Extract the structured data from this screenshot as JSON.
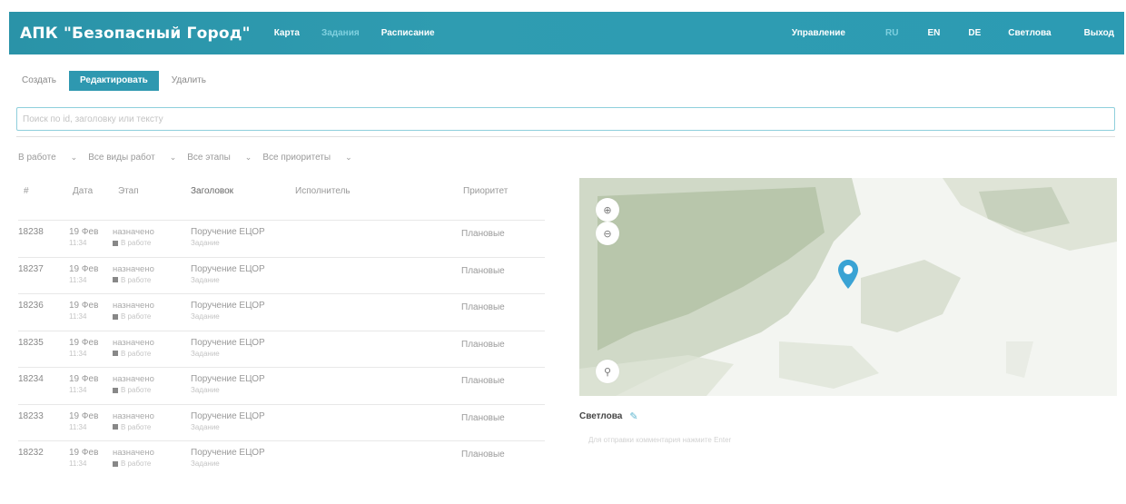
{
  "header": {
    "brand": "АПК \"Безопасный Город\"",
    "nav": [
      "Карта",
      "Задания",
      "Расписание"
    ],
    "right": {
      "manage": "Управление",
      "langs": [
        "RU",
        "EN",
        "DE"
      ],
      "user": "Светлова",
      "logout": "Выход"
    }
  },
  "toolbar": {
    "create": "Создать",
    "edit": "Редактировать",
    "delete": "Удалить"
  },
  "search": {
    "placeholder": "Поиск по id, заголовку или тексту"
  },
  "filters": [
    "В работе",
    "Все виды работ",
    "Все этапы",
    "Все приоритеты"
  ],
  "table": {
    "headers": {
      "id": "#",
      "date": "Дата",
      "stage": "Этап",
      "title": "Заголовок",
      "assignee": "Исполнитель",
      "priority": "Приоритет"
    },
    "rows": [
      {
        "id": "18238",
        "date": "19 Фев",
        "time": "11:34",
        "stage": "назначено",
        "sub": "В работе",
        "title": "Поручение ЕЦОР",
        "desc": "Задание",
        "priority": "Плановые"
      },
      {
        "id": "18237",
        "date": "19 Фев",
        "time": "11:34",
        "stage": "назначено",
        "sub": "В работе",
        "title": "Поручение ЕЦОР",
        "desc": "Задание",
        "priority": "Плановые"
      },
      {
        "id": "18236",
        "date": "19 Фев",
        "time": "11:34",
        "stage": "назначено",
        "sub": "В работе",
        "title": "Поручение ЕЦОР",
        "desc": "Задание",
        "priority": "Плановые"
      },
      {
        "id": "18235",
        "date": "19 Фев",
        "time": "11:34",
        "stage": "назначено",
        "sub": "В работе",
        "title": "Поручение ЕЦОР",
        "desc": "Задание",
        "priority": "Плановые"
      },
      {
        "id": "18234",
        "date": "19 Фев",
        "time": "11:34",
        "stage": "назначено",
        "sub": "В работе",
        "title": "Поручение ЕЦОР",
        "desc": "Задание",
        "priority": "Плановые"
      },
      {
        "id": "18233",
        "date": "19 Фев",
        "time": "11:34",
        "stage": "назначено",
        "sub": "В работе",
        "title": "Поручение ЕЦОР",
        "desc": "Задание",
        "priority": "Плановые"
      },
      {
        "id": "18232",
        "date": "19 Фев",
        "time": "11:34",
        "stage": "назначено",
        "sub": "В работе",
        "title": "Поручение ЕЦОР",
        "desc": "Задание",
        "priority": "Плановые"
      }
    ]
  },
  "map_panel": {
    "user": "Светлова",
    "hint": "Для отправки комментария нажмите Enter"
  },
  "colors": {
    "accent": "#2e98b0",
    "pin": "#3aa3d4"
  }
}
